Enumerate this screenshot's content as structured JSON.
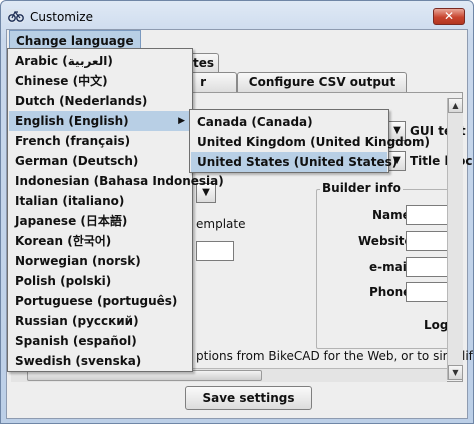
{
  "window": {
    "title": "Customize",
    "close_symbol": "✕",
    "icon": "bike-icon"
  },
  "menubar": {
    "change_language": "Change language"
  },
  "tabs": [
    {
      "label": "tes"
    },
    {
      "label": "r"
    },
    {
      "label": "Configure CSV output"
    }
  ],
  "gui": {
    "gui_text_label": "GUI text",
    "title_block_label": "Title bloc"
  },
  "template_label": "emplate",
  "builder_info": {
    "title": "Builder info",
    "fields": [
      "Name",
      "Website",
      "e-mail",
      "Phone",
      "Logo"
    ]
  },
  "options_text": "ptions from BikeCAD for the Web, or to simplify",
  "save_button": "Save settings",
  "language_menu": {
    "items": [
      "Arabic (العربية)",
      "Chinese (中文)",
      "Dutch (Nederlands)",
      "English (English)",
      "French (français)",
      "German (Deutsch)",
      "Indonesian (Bahasa Indonesia)",
      "Italian (italiano)",
      "Japanese (日本語)",
      "Korean (한국어)",
      "Norwegian (norsk)",
      "Polish (polski)",
      "Portuguese (português)",
      "Russian (русский)",
      "Spanish (español)",
      "Swedish (svenska)"
    ],
    "selected": "English (English)",
    "submenu_arrow": "▶"
  },
  "english_submenu": {
    "items": [
      "Canada (Canada)",
      "United Kingdom (United Kingdom)",
      "United States (United States)"
    ],
    "selected": "United States (United States)"
  },
  "colors": {
    "selection": "#b8cfe5",
    "close_button": "#c8452f"
  }
}
